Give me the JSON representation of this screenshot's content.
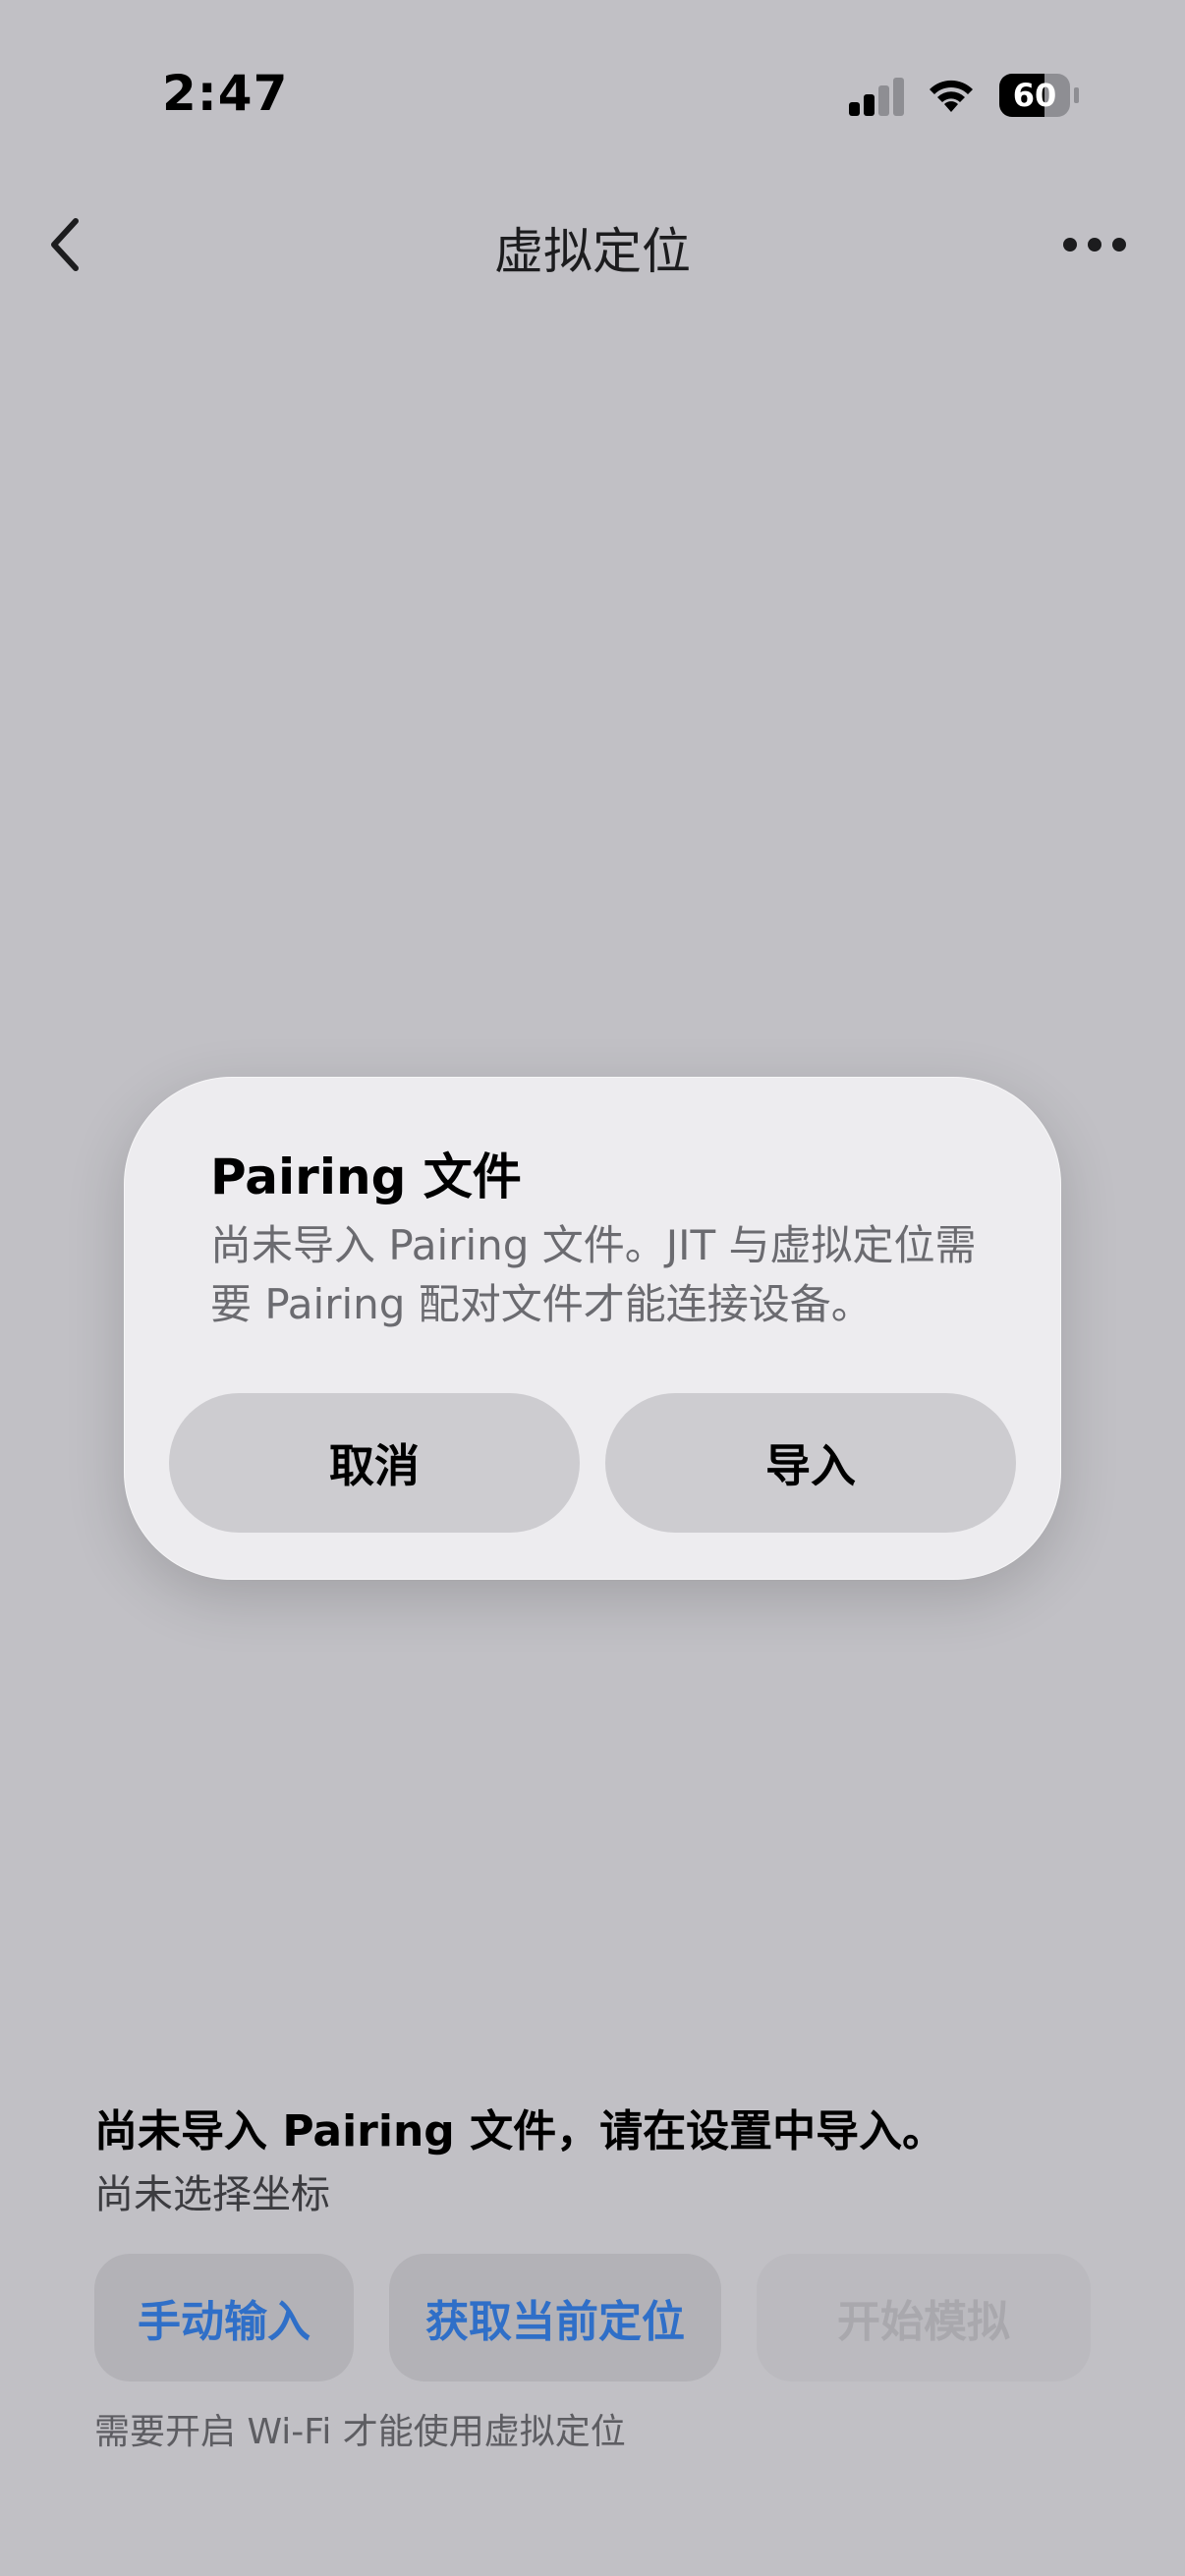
{
  "status_bar": {
    "time": "2:47",
    "battery": "60"
  },
  "nav": {
    "title": "虚拟定位"
  },
  "dialog": {
    "title": "Pairing 文件",
    "message": "尚未导入 Pairing 文件。JIT 与虚拟定位需要 Pairing 配对文件才能连接设备。",
    "cancel_label": "取消",
    "import_label": "导入"
  },
  "status": {
    "main": "尚未导入 Pairing 文件，请在设置中导入。",
    "sub": "尚未选择坐标"
  },
  "actions": {
    "manual_label": "手动输入",
    "current_label": "获取当前定位",
    "start_label": "开始模拟"
  },
  "footnote": "需要开启 Wi-Fi 才能使用虚拟定位",
  "colors": {
    "background": "#c1c0c5",
    "accent": "#2f6fc8",
    "dialog": "#edecef"
  }
}
